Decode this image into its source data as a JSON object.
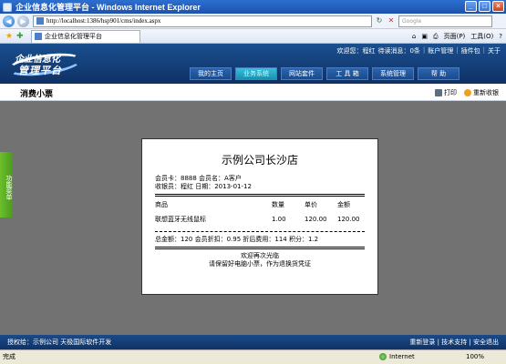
{
  "window": {
    "title": "企业信息化管理平台 - Windows Internet Explorer"
  },
  "address": {
    "url": "http://localhost:1386/hsp901/cms/index.aspx",
    "search_placeholder": "Google"
  },
  "tab": {
    "title": "企业信息化管理平台"
  },
  "commands": {
    "page": "页面(P)",
    "tools": "工具(O)",
    "help_icon": "help-icon"
  },
  "header": {
    "logo_line1": "企业信息化",
    "logo_line2": "管理平台",
    "links": [
      "欢迎您：程红",
      "待读消息：0条",
      "账户管理",
      "插件包",
      "关于"
    ],
    "nav": [
      {
        "label": "我的主页",
        "active": false
      },
      {
        "label": "业务系统",
        "active": true
      },
      {
        "label": "网站套件",
        "active": false
      },
      {
        "label": "工 具 箱",
        "active": false
      },
      {
        "label": "系统管理",
        "active": false
      },
      {
        "label": "帮 助",
        "active": false
      }
    ]
  },
  "toolbar": {
    "page_title": "消费小票",
    "print": "打印",
    "resend": "重新收银"
  },
  "sidebar": {
    "label": "功能菜单"
  },
  "receipt": {
    "title": "示例公司长沙店",
    "member_line": "会员卡：8888  会员名：A客户",
    "cashier_line": "收银员：程红  日期：2013-01-12",
    "headers": [
      "商品",
      "数量",
      "单价",
      "金额"
    ],
    "items": [
      {
        "name": "联想蓝牙无线鼠标",
        "qty": "1.00",
        "price": "120.00",
        "amount": "120.00"
      }
    ],
    "summary": "总金额：120 会员折扣：0.95 折后费用：114 积分：1.2",
    "welcome": "欢迎再次光临",
    "notice": "请保留好电脑小票，作为退换货凭证"
  },
  "footer": {
    "left": "授权给：示例公司  天极国际软件开发",
    "right": "重新登录 | 技术支持 | 安全退出"
  },
  "status": {
    "left": "完成",
    "zone": "Internet",
    "zoom": "100%"
  }
}
